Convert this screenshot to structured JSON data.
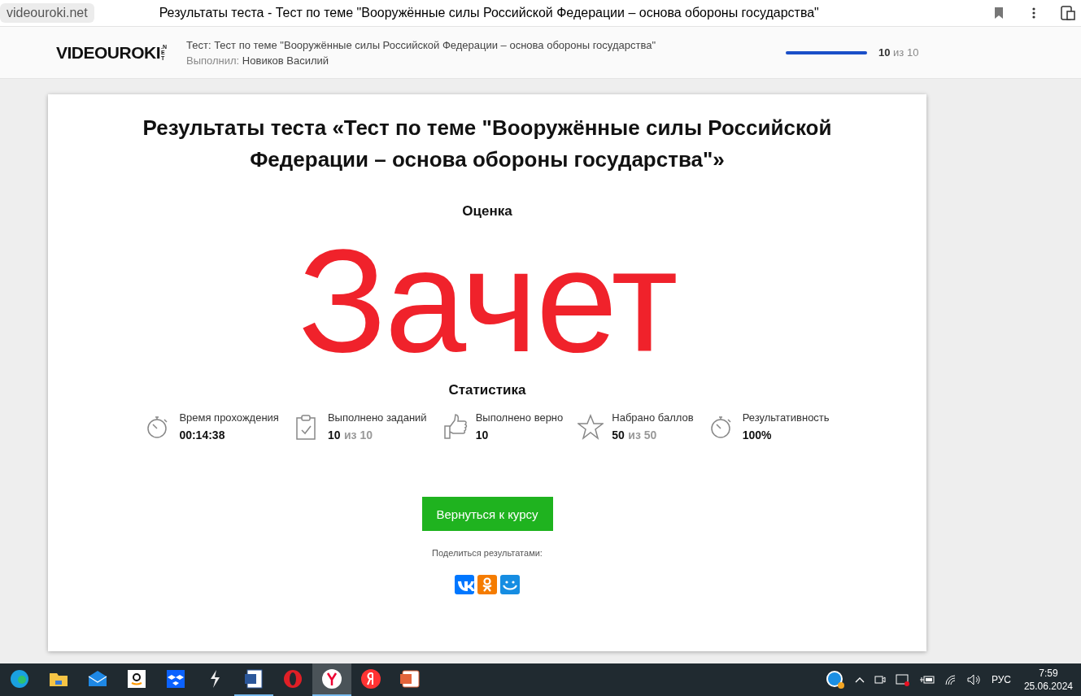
{
  "browser": {
    "address": "videouroki.net",
    "page_title": "Результаты теста - Тест по теме \"Вооружённые силы Российской Федерации – основа обороны государства\""
  },
  "header": {
    "logo": "VIDEOUROKI",
    "logo_suffix": ".NET",
    "test_label": "Тест:",
    "test_name": "Тест по теме \"Вооружённые силы Российской Федерации – основа обороны государства\"",
    "author_label": "Выполнил:",
    "author_name": "Новиков Василий",
    "progress": {
      "level": 1.0,
      "value": "10",
      "total": "из 10"
    }
  },
  "result": {
    "title": "Результаты теста «Тест по теме \"Вооружённые силы Российской Федерации – основа обороны государства\"»",
    "grade_label": "Оценка",
    "grade": "Зачет",
    "stats_label": "Статистика",
    "stats": [
      {
        "kind": "stopwatch",
        "label": "Время прохождения",
        "value": "00:14:38"
      },
      {
        "kind": "clipboard",
        "label": "Выполнено заданий",
        "value": "10",
        "total": "из 10"
      },
      {
        "kind": "thumb",
        "label": "Выполнено верно",
        "value": "10"
      },
      {
        "kind": "star",
        "label": "Набрано баллов",
        "value": "50",
        "total": "из 50"
      },
      {
        "kind": "stopwatch",
        "label": "Результативность",
        "value": "100%"
      }
    ],
    "button": "Вернуться к курсу",
    "share_label": "Поделиться результатами:",
    "share": [
      {
        "kind": "vk",
        "color": "#0077ff"
      },
      {
        "kind": "ok",
        "color": "#f57c00"
      },
      {
        "kind": "mail",
        "color": "#168de2"
      }
    ]
  },
  "taskbar": {
    "apps": [
      {
        "kind": "edge",
        "open": false,
        "selected": false
      },
      {
        "kind": "folder",
        "open": false,
        "selected": false
      },
      {
        "kind": "mail",
        "open": false,
        "selected": false
      },
      {
        "kind": "amazon",
        "open": false,
        "selected": false
      },
      {
        "kind": "dropbox",
        "open": false,
        "selected": false
      },
      {
        "kind": "bolt",
        "open": false,
        "selected": false
      },
      {
        "kind": "word",
        "open": true,
        "selected": false
      },
      {
        "kind": "opera",
        "open": false,
        "selected": false
      },
      {
        "kind": "ybrowser",
        "open": true,
        "selected": true
      },
      {
        "kind": "yandex",
        "open": false,
        "selected": false
      },
      {
        "kind": "slides",
        "open": false,
        "selected": false
      }
    ],
    "language": "РУС",
    "time": "7:59",
    "date": "25.06.2024"
  }
}
